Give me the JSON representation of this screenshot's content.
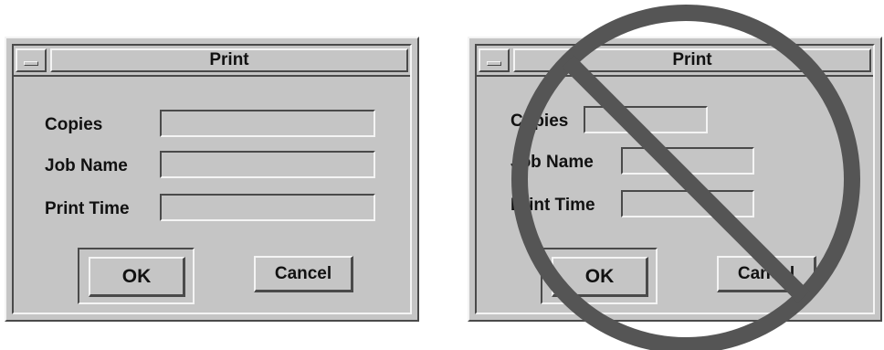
{
  "dialogs": [
    {
      "title": "Print",
      "copies_label": "Copies",
      "copies_value": "",
      "job_name_label": "Job Name",
      "job_name_value": "",
      "print_time_label": "Print Time",
      "print_time_value": "",
      "ok_label": "OK",
      "cancel_label": "Cancel"
    },
    {
      "title": "Print",
      "copies_label": "Copies",
      "copies_value": "",
      "job_name_label": "Job Name",
      "job_name_value": "",
      "print_time_label": "Print Time",
      "print_time_value": "",
      "ok_label": "OK",
      "cancel_label": "Cancel"
    }
  ],
  "overlay": {
    "icon": "prohibition-icon",
    "color": "#555555"
  },
  "colors": {
    "dialog_bg": "#c5c5c5",
    "highlight": "#f4f4f4",
    "shadow": "#4a4a4a"
  }
}
